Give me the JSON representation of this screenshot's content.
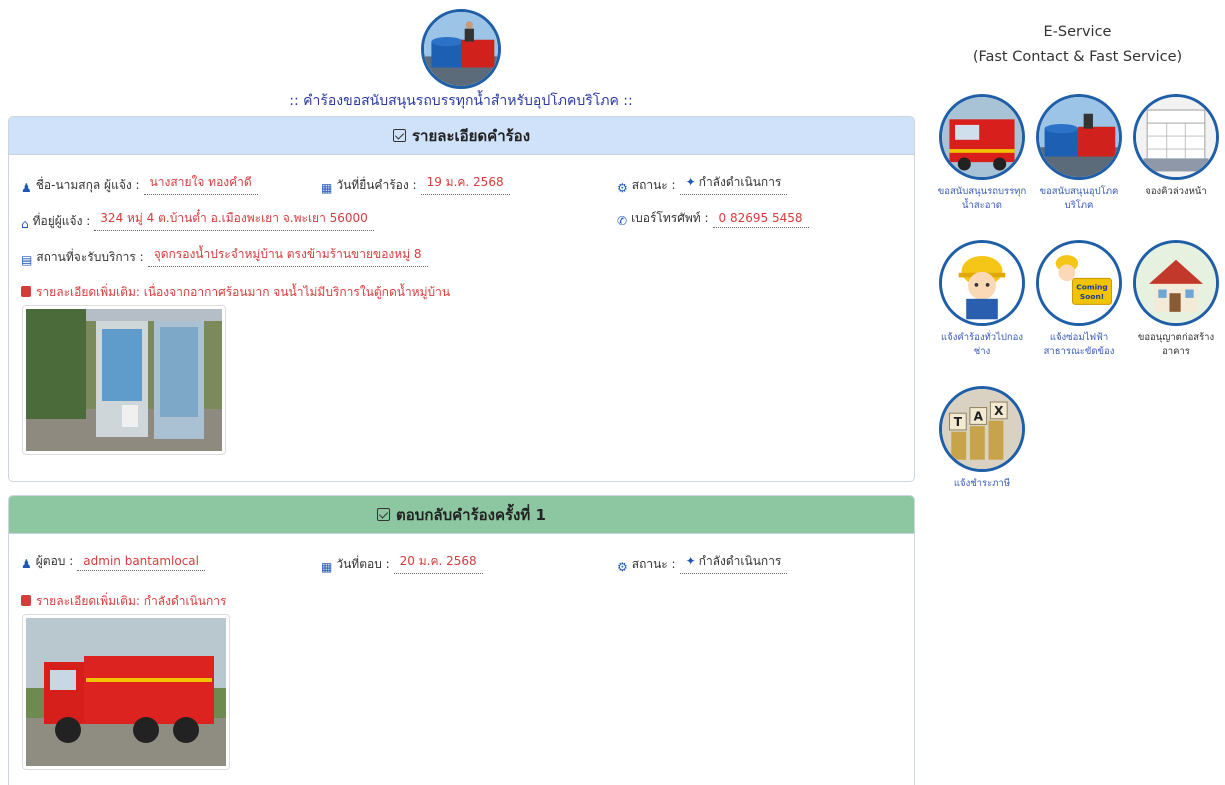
{
  "page": {
    "title": ":: คำร้องขอสนับสนุนรถบรรทุกน้ำสำหรับอุปโภคบริโภค ::"
  },
  "request_card": {
    "header": "รายละเอียดคำร้อง",
    "requester_label": "ชื่อ-นามสกุล ผู้แจ้ง :",
    "requester_value": "นางสายใจ ทองคำดี",
    "date_label": "วันที่ยื่นคำร้อง :",
    "date_value": "19 ม.ค. 2568",
    "status_label": "สถานะ :",
    "status_value": "กำลังดำเนินการ",
    "address_label": "ที่อยู่ผู้แจ้ง :",
    "address_value": "324 หมู่ 4 ต.บ้านต๋ำ อ.เมืองพะเยา จ.พะเยา 56000",
    "phone_label": "เบอร์โทรศัพท์ :",
    "phone_value": "0 82695 5458",
    "place_label": "สถานที่จะรับบริการ :",
    "place_value": "จุดกรองน้ำประจำหมู่บ้าน ตรงข้ามร้านขายของหมู่ 8",
    "detail": "รายละเอียดเพิ่มเติม: เนื่องจากอากาศร้อนมาก จนน้ำไม่มีบริการในตู้กดน้ำหมู่บ้าน"
  },
  "reply_card": {
    "header": "ตอบกลับคำร้องครั้งที่ 1",
    "responder_label": "ผู้ตอบ :",
    "responder_value": "admin bantamlocal",
    "date_label": "วันที่ตอบ :",
    "date_value": "20 ม.ค. 2568",
    "status_label": "สถานะ :",
    "status_value": "กำลังดำเนินการ",
    "detail": "รายละเอียดเพิ่มเติม: กำลังดำเนินการ"
  },
  "sidebar": {
    "title_line1": "E-Service",
    "title_line2": "(Fast Contact & Fast Service)",
    "services": [
      {
        "label": "ขอสนับสนุนรถบรรทุกน้ำสะอาด",
        "icon": "fire-truck-icon"
      },
      {
        "label": "ขอสนับสนุนอุปโภคบริโภค",
        "icon": "water-truck-icon"
      },
      {
        "label": "จองคิวล่วงหน้า",
        "icon": "calendar-icon"
      },
      {
        "label": "แจ้งคำร้องทั่วไปกองช่าง",
        "icon": "engineer-icon"
      },
      {
        "label": "แจ้งซ่อมไฟฟ้าสาธารณะขัดข้อง",
        "icon": "coming-soon-icon"
      },
      {
        "label": "ขออนุญาตก่อสร้างอาคาร",
        "icon": "house-icon"
      },
      {
        "label": "แจ้งชำระภาษี",
        "icon": "tax-icon"
      }
    ],
    "coming_soon_text": "Coming Soon!",
    "tax_text": "TAX"
  },
  "colors": {
    "request_header": "#cfe2fa",
    "reply_header": "#8cc7a1",
    "value_red": "#d63c3c",
    "title_blue": "#2b3aa6",
    "icon_blue": "#1e57b5"
  }
}
